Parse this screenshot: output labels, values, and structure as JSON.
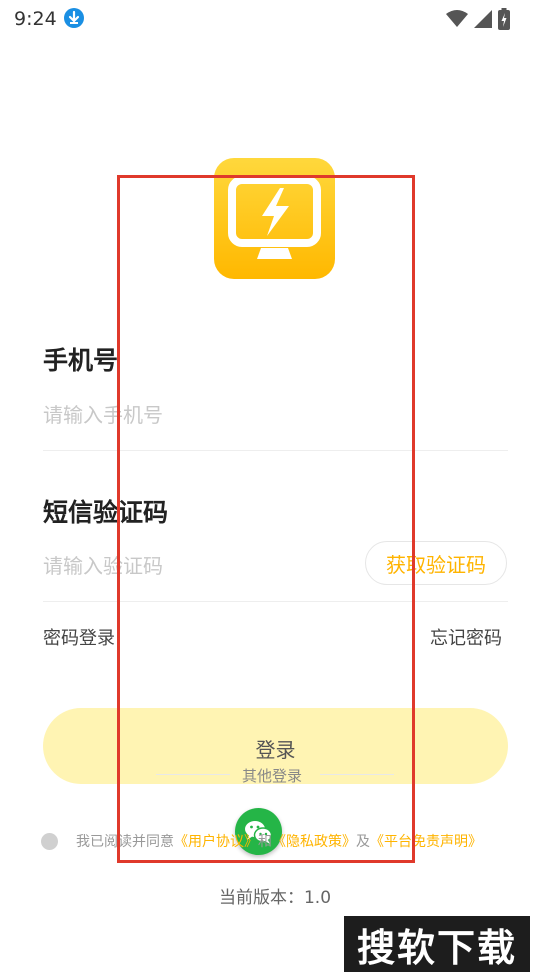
{
  "status_bar": {
    "time": "9:24"
  },
  "phone": {
    "label": "手机号",
    "placeholder": "请输入手机号"
  },
  "sms": {
    "label": "短信验证码",
    "placeholder": "请输入验证码",
    "get_code": "获取验证码"
  },
  "links": {
    "password_login": "密码登录",
    "forgot_password": "忘记密码"
  },
  "login": {
    "label": "登录"
  },
  "other_login": {
    "label": "其他登录"
  },
  "agreement": {
    "prefix": "我已阅读并同意",
    "user_agreement": "《用户协议》",
    "and": "和",
    "privacy": "《隐私政策》",
    "and2": "及",
    "disclaimer": "《平台免责声明》"
  },
  "version": {
    "text": "当前版本：1.0"
  },
  "watermark": {
    "text": "搜软下载"
  },
  "colors": {
    "accent": "#ffb400",
    "login_bg": "#fff4b3",
    "annotation": "#e0392b",
    "wechat": "#25b547"
  },
  "icons": [
    "download-icon",
    "wifi-icon",
    "signal-icon",
    "battery-icon",
    "app-logo-icon",
    "wechat-icon"
  ]
}
